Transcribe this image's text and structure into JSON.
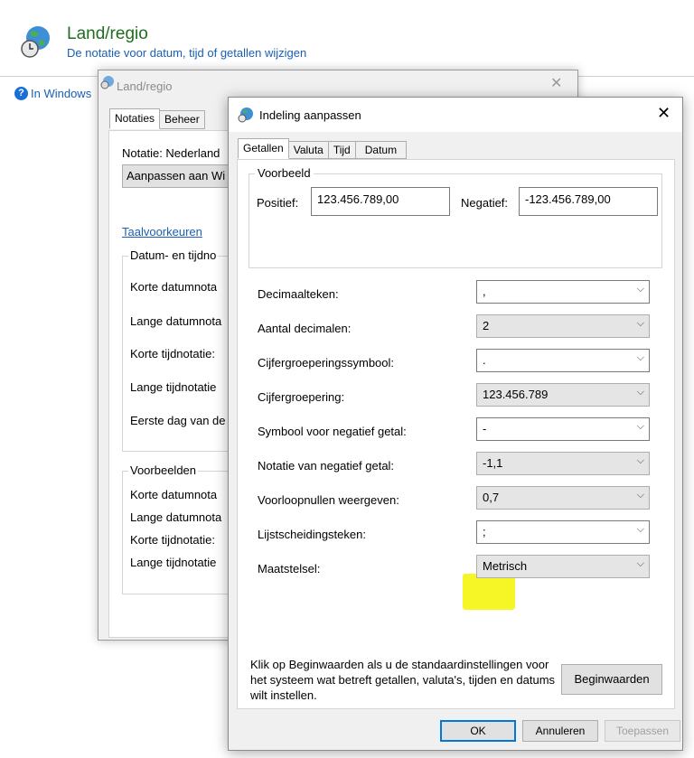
{
  "control_panel": {
    "title": "Land/regio",
    "subtitle": "De notatie voor datum, tijd of getallen wijzigen",
    "help_link": "In Windows",
    "help_icon": "?"
  },
  "region_dialog": {
    "title": "Land/regio",
    "close": "✕",
    "tabs": [
      "Notaties",
      "Beheer"
    ],
    "notatie_label": "Notatie: Nederland",
    "match_button": "Aanpassen aan Wi",
    "language_link": "Taalvoorkeuren",
    "datetime_group": "Datum- en tijdno",
    "datetime_rows": [
      "Korte datumnota",
      "Lange datumnota",
      "Korte tijdnotatie:",
      "Lange tijdnotatie",
      "Eerste dag van de"
    ],
    "examples_group": "Voorbeelden",
    "example_rows": [
      "Korte datumnota",
      "Lange datumnota",
      "Korte tijdnotatie:",
      "Lange tijdnotatie"
    ]
  },
  "format_dialog": {
    "title": "Indeling aanpassen",
    "close": "✕",
    "tabs": [
      "Getallen",
      "Valuta",
      "Tijd",
      "Datum"
    ],
    "preview_legend": "Voorbeeld",
    "positive_label": "Positief:",
    "positive_value": "123.456.789,00",
    "negative_label": "Negatief:",
    "negative_value": "-123.456.789,00",
    "settings": [
      {
        "label": "Decimaalteken:",
        "value": ","
      },
      {
        "label": "Aantal decimalen:",
        "value": "2"
      },
      {
        "label": "Cijfergroeperingssymbool:",
        "value": "."
      },
      {
        "label": "Cijfergroepering:",
        "value": "123.456.789"
      },
      {
        "label": "Symbool voor negatief getal:",
        "value": "-"
      },
      {
        "label": "Notatie van negatief getal:",
        "value": "-1,1"
      },
      {
        "label": "Voorloopnullen weergeven:",
        "value": "0,7"
      },
      {
        "label": "Lijstscheidingsteken:",
        "value": ";"
      },
      {
        "label": "Maatstelsel:",
        "value": "Metrisch"
      }
    ],
    "note": "Klik op Beginwaarden als u de standaardinstellingen voor het systeem wat betreft getallen, valuta's, tijden en datums wilt instellen.",
    "reset_button": "Beginwaarden",
    "ok_button": "OK",
    "cancel_button": "Annuleren",
    "apply_button": "Toepassen",
    "dropdown_chevron": "⌵",
    "highlight_color": "#f5f500"
  }
}
